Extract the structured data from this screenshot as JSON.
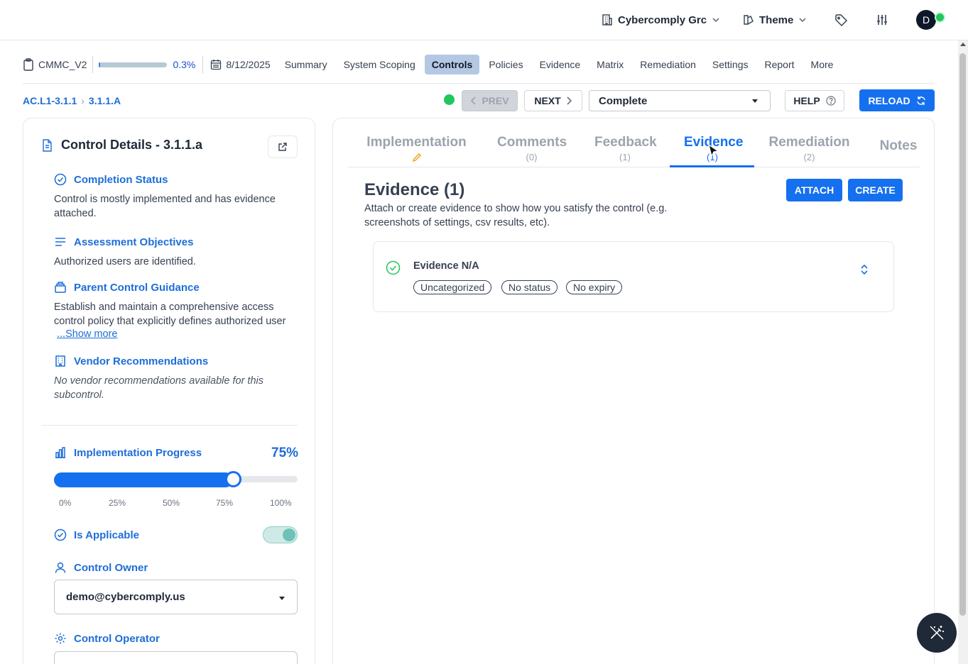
{
  "header": {
    "org_name": "Cybercomply Grc",
    "theme_label": "Theme",
    "avatar_initial": "D"
  },
  "nav": {
    "project": "CMMC_V2",
    "progress_pct_value": 0.3,
    "progress_label": "0.3%",
    "date": "8/12/2025",
    "tabs": [
      {
        "label": "Summary"
      },
      {
        "label": "System Scoping"
      },
      {
        "label": "Controls",
        "active": true
      },
      {
        "label": "Policies"
      },
      {
        "label": "Evidence"
      },
      {
        "label": "Matrix"
      },
      {
        "label": "Remediation"
      },
      {
        "label": "Settings"
      },
      {
        "label": "Report"
      },
      {
        "label": "More"
      }
    ]
  },
  "breadcrumb": {
    "parent": "AC.L1-3.1.1",
    "separator": "›",
    "current": "3.1.1.A"
  },
  "toolbar": {
    "prev_label": "PREV",
    "next_label": "NEXT",
    "status_value": "Complete",
    "help_label": "HELP",
    "reload_label": "RELOAD",
    "status_color": "#22c55e"
  },
  "control": {
    "title": "Control Details - 3.1.1.a",
    "completion_status_heading": "Completion Status",
    "completion_status_text": "Control is mostly implemented and has evidence attached.",
    "objectives_heading": "Assessment Objectives",
    "objectives_text": "Authorized users are identified.",
    "guidance_heading": "Parent Control Guidance",
    "guidance_text": "Establish and maintain a comprehensive access control policy that explicitly defines authorized user",
    "show_more_label": "...Show more",
    "vendor_heading": "Vendor Recommendations",
    "vendor_text": "No vendor recommendations available for this subcontrol.",
    "progress_heading": "Implementation Progress",
    "progress_value": 75,
    "progress_label": "75%",
    "progress_ticks": [
      "0%",
      "25%",
      "50%",
      "75%",
      "100%"
    ],
    "applicable_heading": "Is Applicable",
    "applicable_on": true,
    "owner_heading": "Control Owner",
    "owner_value": "demo@cybercomply.us",
    "operator_heading": "Control Operator"
  },
  "right_tabs": [
    {
      "label": "Implementation",
      "count": ""
    },
    {
      "label": "Comments",
      "count": "(0)"
    },
    {
      "label": "Feedback",
      "count": "(1)"
    },
    {
      "label": "Evidence",
      "count": "(1)",
      "active": true
    },
    {
      "label": "Remediation",
      "count": "(2)"
    },
    {
      "label": "Notes",
      "count": ""
    }
  ],
  "evidence": {
    "title": "Evidence (1)",
    "description": "Attach or create evidence to show how you satisfy the control (e.g. screenshots of settings, csv results, etc).",
    "attach_label": "ATTACH",
    "create_label": "CREATE",
    "items": [
      {
        "name": "Evidence N/A",
        "chips": [
          "Uncategorized",
          "No status",
          "No expiry"
        ]
      }
    ]
  },
  "colors": {
    "accent": "#1570ef",
    "active_tab_bg": "#b4c8e4",
    "success": "#22c55e"
  },
  "icons": {
    "org": "building-icon",
    "theme": "palette-icon",
    "tag": "tag-icon",
    "settings": "sliders-icon",
    "fab": "magic-wand-icon"
  }
}
